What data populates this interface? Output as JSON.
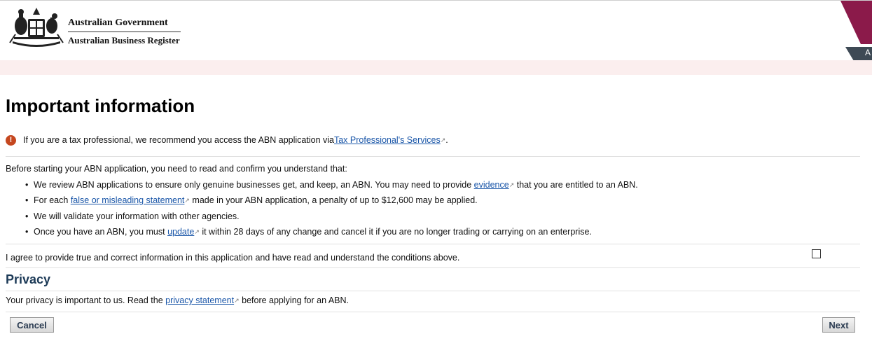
{
  "header": {
    "line1": "Australian Government",
    "line2": "Australian Business Register",
    "corner_text": "A",
    "corner_colors": [
      "#8b1a4a",
      "#3e4a55"
    ]
  },
  "main": {
    "title": "Important information",
    "alert": {
      "icon": "exclamation-icon",
      "before": "If you are a tax professional, we recommend you access the ABN application via ",
      "link": "Tax Professional's Services",
      "after": "."
    },
    "intro": "Before starting your ABN application, you need to read and confirm you understand that:",
    "conditions": [
      {
        "before": "We review ABN applications to ensure only genuine businesses get, and keep, an ABN. You may need to provide ",
        "link": "evidence",
        "after": " that you are entitled to an ABN."
      },
      {
        "before": "For each ",
        "link": "false or misleading statement",
        "after": " made in your ABN application, a penalty of up to $12,600 may be applied."
      },
      {
        "before": "We will validate your information with other agencies.",
        "link": "",
        "after": ""
      },
      {
        "before": "Once you have an ABN, you must ",
        "link": "update",
        "after": " it within 28 days of any change and cancel it if you are no longer trading or carrying on an enterprise."
      }
    ],
    "agree_label": "I agree to provide true and correct information in this application and have read and understand the conditions above.",
    "agree_checked": false,
    "privacy_heading": "Privacy",
    "privacy": {
      "before": "Your privacy is important to us. Read the ",
      "link": "privacy statement",
      "after": " before applying for an ABN."
    }
  },
  "buttons": {
    "cancel": "Cancel",
    "next": "Next"
  },
  "colors": {
    "link": "#1a56a8",
    "alert_icon": "#c5471f",
    "band": "#fbeeee",
    "heading2": "#1c3a57"
  },
  "ext_icon_glyph": "↗"
}
